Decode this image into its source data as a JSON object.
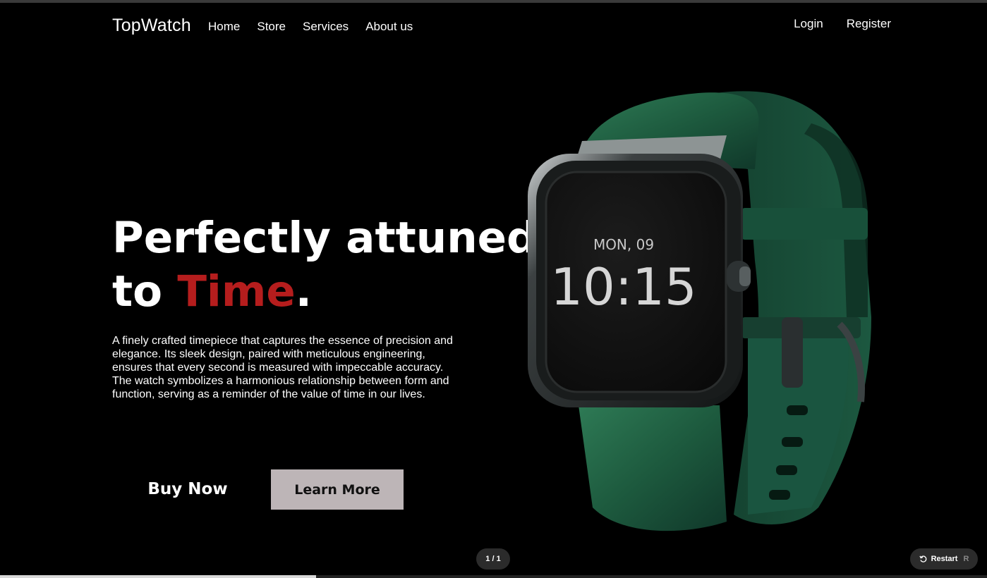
{
  "header": {
    "brand": "TopWatch",
    "nav": [
      "Home",
      "Store",
      "Services",
      "About us"
    ],
    "login": "Login",
    "register": "Register"
  },
  "hero": {
    "title_line1": "Perfectly attuned",
    "title_line2_prefix": "to ",
    "title_accent": "Time",
    "title_suffix": ".",
    "description": "A finely crafted timepiece that captures the essence of precision and elegance. Its sleek design, paired with meticulous engineering, ensures that every second is measured with impeccable accuracy. The watch symbolizes a harmonious relationship between form and function, serving as a reminder of the value of time in our lives.",
    "buy_label": "Buy Now",
    "learn_label": "Learn More"
  },
  "watch": {
    "date": "MON, 09",
    "time": "10:15"
  },
  "viewer": {
    "pager": "1 / 1",
    "restart_label": "Restart",
    "restart_key": "R",
    "progress": 0.32
  },
  "colors": {
    "background": "#000000",
    "accent": "#b51d1d",
    "learn_button": "#bdb5b7",
    "strap": "#1f5a3f"
  },
  "icons": {
    "restart": "restart-icon"
  }
}
